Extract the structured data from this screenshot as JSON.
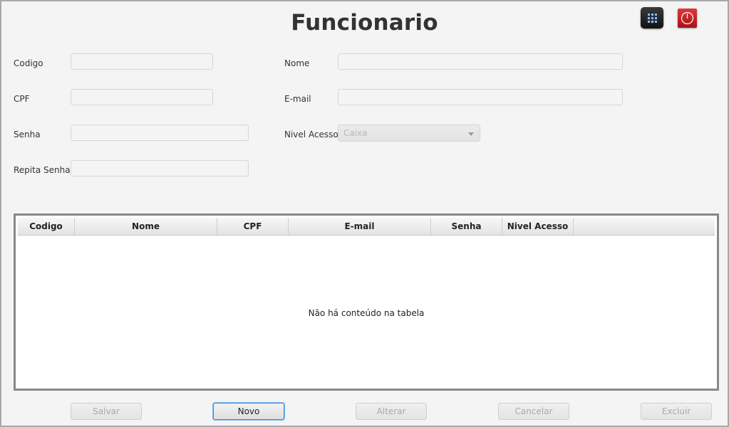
{
  "title": "Funcionario",
  "toolbar": {
    "menu_icon": "apps-menu-icon",
    "power_icon": "power-off-icon"
  },
  "form": {
    "codigo": {
      "label": "Codigo",
      "value": ""
    },
    "nome": {
      "label": "Nome",
      "value": ""
    },
    "cpf": {
      "label": "CPF",
      "value": ""
    },
    "email": {
      "label": "E-mail",
      "value": ""
    },
    "senha": {
      "label": "Senha",
      "value": ""
    },
    "nivel_acesso": {
      "label": "Nivel Acesso",
      "selected": "Caixa"
    },
    "repita_senha": {
      "label": "Repita Senha",
      "value": ""
    }
  },
  "table": {
    "columns": [
      "Codigo",
      "Nome",
      "CPF",
      "E-mail",
      "Senha",
      "Nivel Acesso"
    ],
    "rows": [],
    "empty_text": "Não há conteúdo na tabela"
  },
  "buttons": {
    "salvar": "Salvar",
    "novo": "Novo",
    "alterar": "Alterar",
    "cancelar": "Cancelar",
    "excluir": "Excluir"
  },
  "colors": {
    "accent": "#3a8ad6",
    "power": "#d32a2e",
    "table_border": "#888888"
  }
}
